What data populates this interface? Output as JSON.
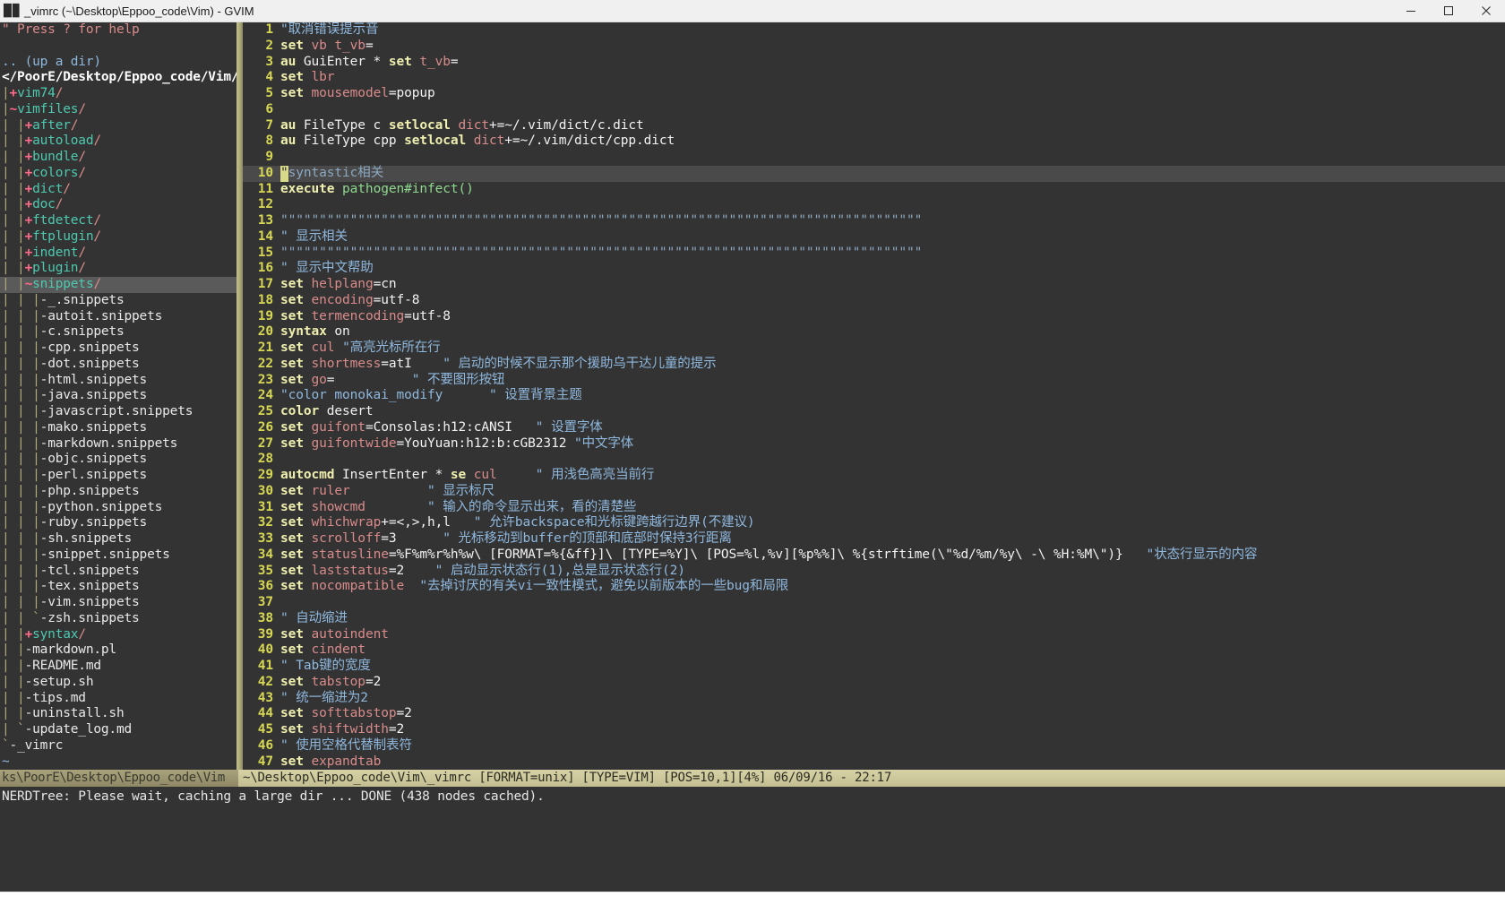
{
  "window": {
    "title": "_vimrc (~\\Desktop\\Eppoo_code\\Vim) - GVIM",
    "icon": "gvim-icon",
    "minimize_label": "─",
    "maximize_label": "❐",
    "close_label": "✕"
  },
  "nerdtree": {
    "help_line": "\" Press ? for help",
    "blank_line": "",
    "up_a_dir": ".. (up a dir)",
    "root_path": "</PoorE/Desktop/Eppoo_code/Vim/",
    "items": [
      {
        "indent": "|",
        "marker": "+",
        "label": "vim74/",
        "type": "dir"
      },
      {
        "indent": "|",
        "marker": "~",
        "label": "vimfiles/",
        "type": "dir"
      },
      {
        "indent": "| |",
        "marker": "+",
        "label": "after/",
        "type": "dir"
      },
      {
        "indent": "| |",
        "marker": "+",
        "label": "autoload/",
        "type": "dir"
      },
      {
        "indent": "| |",
        "marker": "+",
        "label": "bundle/",
        "type": "dir"
      },
      {
        "indent": "| |",
        "marker": "+",
        "label": "colors/",
        "type": "dir"
      },
      {
        "indent": "| |",
        "marker": "+",
        "label": "dict/",
        "type": "dir"
      },
      {
        "indent": "| |",
        "marker": "+",
        "label": "doc/",
        "type": "dir"
      },
      {
        "indent": "| |",
        "marker": "+",
        "label": "ftdetect/",
        "type": "dir"
      },
      {
        "indent": "| |",
        "marker": "+",
        "label": "ftplugin/",
        "type": "dir"
      },
      {
        "indent": "| |",
        "marker": "+",
        "label": "indent/",
        "type": "dir"
      },
      {
        "indent": "| |",
        "marker": "+",
        "label": "plugin/",
        "type": "dir"
      },
      {
        "indent": "| |",
        "marker": "~",
        "label": "snippets/",
        "type": "dir",
        "selected": true
      },
      {
        "indent": "| | |",
        "marker": "-",
        "label": "_.snippets",
        "type": "file"
      },
      {
        "indent": "| | |",
        "marker": "-",
        "label": "autoit.snippets",
        "type": "file"
      },
      {
        "indent": "| | |",
        "marker": "-",
        "label": "c.snippets",
        "type": "file"
      },
      {
        "indent": "| | |",
        "marker": "-",
        "label": "cpp.snippets",
        "type": "file"
      },
      {
        "indent": "| | |",
        "marker": "-",
        "label": "dot.snippets",
        "type": "file"
      },
      {
        "indent": "| | |",
        "marker": "-",
        "label": "html.snippets",
        "type": "file"
      },
      {
        "indent": "| | |",
        "marker": "-",
        "label": "java.snippets",
        "type": "file"
      },
      {
        "indent": "| | |",
        "marker": "-",
        "label": "javascript.snippets",
        "type": "file"
      },
      {
        "indent": "| | |",
        "marker": "-",
        "label": "mako.snippets",
        "type": "file"
      },
      {
        "indent": "| | |",
        "marker": "-",
        "label": "markdown.snippets",
        "type": "file"
      },
      {
        "indent": "| | |",
        "marker": "-",
        "label": "objc.snippets",
        "type": "file"
      },
      {
        "indent": "| | |",
        "marker": "-",
        "label": "perl.snippets",
        "type": "file"
      },
      {
        "indent": "| | |",
        "marker": "-",
        "label": "php.snippets",
        "type": "file"
      },
      {
        "indent": "| | |",
        "marker": "-",
        "label": "python.snippets",
        "type": "file"
      },
      {
        "indent": "| | |",
        "marker": "-",
        "label": "ruby.snippets",
        "type": "file"
      },
      {
        "indent": "| | |",
        "marker": "-",
        "label": "sh.snippets",
        "type": "file"
      },
      {
        "indent": "| | |",
        "marker": "-",
        "label": "snippet.snippets",
        "type": "file"
      },
      {
        "indent": "| | |",
        "marker": "-",
        "label": "tcl.snippets",
        "type": "file"
      },
      {
        "indent": "| | |",
        "marker": "-",
        "label": "tex.snippets",
        "type": "file"
      },
      {
        "indent": "| | |",
        "marker": "-",
        "label": "vim.snippets",
        "type": "file"
      },
      {
        "indent": "| | `",
        "marker": "-",
        "label": "zsh.snippets",
        "type": "file"
      },
      {
        "indent": "| |",
        "marker": "+",
        "label": "syntax/",
        "type": "dir"
      },
      {
        "indent": "| |",
        "marker": "-",
        "label": "markdown.pl",
        "type": "file"
      },
      {
        "indent": "| |",
        "marker": "-",
        "label": "README.md",
        "type": "file"
      },
      {
        "indent": "| |",
        "marker": "-",
        "label": "setup.sh",
        "type": "file"
      },
      {
        "indent": "| |",
        "marker": "-",
        "label": "tips.md",
        "type": "file"
      },
      {
        "indent": "| |",
        "marker": "-",
        "label": "uninstall.sh",
        "type": "file"
      },
      {
        "indent": "| `",
        "marker": "-",
        "label": "update_log.md",
        "type": "file"
      },
      {
        "indent": "`",
        "marker": "-",
        "label": "_vimrc",
        "type": "file"
      }
    ]
  },
  "editor": {
    "lines": [
      {
        "n": 1,
        "segs": [
          {
            "t": "\"取消错误提示音",
            "c": "c-cmt"
          }
        ]
      },
      {
        "n": 2,
        "segs": [
          {
            "t": "set ",
            "c": "c-kw"
          },
          {
            "t": "vb t_vb",
            "c": "c-opt"
          },
          {
            "t": "=",
            "c": "c-white"
          }
        ]
      },
      {
        "n": 3,
        "segs": [
          {
            "t": "au ",
            "c": "c-kw"
          },
          {
            "t": "GuiEnter * ",
            "c": "c-white"
          },
          {
            "t": "set ",
            "c": "c-kw"
          },
          {
            "t": "t_vb",
            "c": "c-opt"
          },
          {
            "t": "=",
            "c": "c-white"
          }
        ]
      },
      {
        "n": 4,
        "segs": [
          {
            "t": "set ",
            "c": "c-kw"
          },
          {
            "t": "lbr",
            "c": "c-opt"
          }
        ]
      },
      {
        "n": 5,
        "segs": [
          {
            "t": "set ",
            "c": "c-kw"
          },
          {
            "t": "mousemodel",
            "c": "c-opt"
          },
          {
            "t": "=popup",
            "c": "c-white"
          }
        ]
      },
      {
        "n": 6,
        "segs": []
      },
      {
        "n": 7,
        "segs": [
          {
            "t": "au ",
            "c": "c-kw"
          },
          {
            "t": "FileType c ",
            "c": "c-white"
          },
          {
            "t": "setlocal ",
            "c": "c-kw"
          },
          {
            "t": "dict",
            "c": "c-opt"
          },
          {
            "t": "+=~/.vim/dict/c.dict",
            "c": "c-white"
          }
        ]
      },
      {
        "n": 8,
        "segs": [
          {
            "t": "au ",
            "c": "c-kw"
          },
          {
            "t": "FileType cpp ",
            "c": "c-white"
          },
          {
            "t": "setlocal ",
            "c": "c-kw"
          },
          {
            "t": "dict",
            "c": "c-opt"
          },
          {
            "t": "+=~/.vim/dict/cpp.dict",
            "c": "c-white"
          }
        ]
      },
      {
        "n": 9,
        "segs": []
      },
      {
        "n": 10,
        "cursorline": true,
        "cursor": "\"",
        "segs": [
          {
            "t": "syntastic相关",
            "c": "c-cmt2"
          }
        ]
      },
      {
        "n": 11,
        "segs": [
          {
            "t": "execute ",
            "c": "c-kw"
          },
          {
            "t": "pathogen#infect()",
            "c": "c-fn"
          }
        ]
      },
      {
        "n": 12,
        "segs": []
      },
      {
        "n": 13,
        "segs": [
          {
            "t": "\"\"\"\"\"\"\"\"\"\"\"\"\"\"\"\"\"\"\"\"\"\"\"\"\"\"\"\"\"\"\"\"\"\"\"\"\"\"\"\"\"\"\"\"\"\"\"\"\"\"\"\"\"\"\"\"\"\"\"\"\"\"\"\"\"\"\"\"\"\"\"\"\"\"\"\"\"\"\"\"\"\"\"",
            "c": "c-cmt2"
          }
        ]
      },
      {
        "n": 14,
        "segs": [
          {
            "t": "\" 显示相关",
            "c": "c-cmt"
          }
        ]
      },
      {
        "n": 15,
        "segs": [
          {
            "t": "\"\"\"\"\"\"\"\"\"\"\"\"\"\"\"\"\"\"\"\"\"\"\"\"\"\"\"\"\"\"\"\"\"\"\"\"\"\"\"\"\"\"\"\"\"\"\"\"\"\"\"\"\"\"\"\"\"\"\"\"\"\"\"\"\"\"\"\"\"\"\"\"\"\"\"\"\"\"\"\"\"\"\"",
            "c": "c-cmt2"
          }
        ]
      },
      {
        "n": 16,
        "segs": [
          {
            "t": "\" 显示中文帮助",
            "c": "c-cmt"
          }
        ]
      },
      {
        "n": 17,
        "segs": [
          {
            "t": "set ",
            "c": "c-kw"
          },
          {
            "t": "helplang",
            "c": "c-opt"
          },
          {
            "t": "=cn",
            "c": "c-white"
          }
        ]
      },
      {
        "n": 18,
        "segs": [
          {
            "t": "set ",
            "c": "c-kw"
          },
          {
            "t": "encoding",
            "c": "c-opt"
          },
          {
            "t": "=utf-8",
            "c": "c-white"
          }
        ]
      },
      {
        "n": 19,
        "segs": [
          {
            "t": "set ",
            "c": "c-kw"
          },
          {
            "t": "termencoding",
            "c": "c-opt"
          },
          {
            "t": "=utf-8",
            "c": "c-white"
          }
        ]
      },
      {
        "n": 20,
        "segs": [
          {
            "t": "syntax ",
            "c": "c-kw"
          },
          {
            "t": "on",
            "c": "c-white"
          }
        ]
      },
      {
        "n": 21,
        "segs": [
          {
            "t": "set ",
            "c": "c-kw"
          },
          {
            "t": "cul ",
            "c": "c-opt"
          },
          {
            "t": "\"高亮光标所在行",
            "c": "c-cmt"
          }
        ]
      },
      {
        "n": 22,
        "segs": [
          {
            "t": "set ",
            "c": "c-kw"
          },
          {
            "t": "shortmess",
            "c": "c-opt"
          },
          {
            "t": "=atI",
            "c": "c-white"
          },
          {
            "t": "    \" 启动的时候不显示那个援助乌干达儿童的提示",
            "c": "c-cmt"
          }
        ]
      },
      {
        "n": 23,
        "segs": [
          {
            "t": "set ",
            "c": "c-kw"
          },
          {
            "t": "go",
            "c": "c-opt"
          },
          {
            "t": "=",
            "c": "c-white"
          },
          {
            "t": "          \" 不要图形按钮",
            "c": "c-cmt"
          }
        ]
      },
      {
        "n": 24,
        "segs": [
          {
            "t": "\"color monokai_modify      \" 设置背景主题",
            "c": "c-cmt"
          }
        ]
      },
      {
        "n": 25,
        "segs": [
          {
            "t": "color ",
            "c": "c-kw"
          },
          {
            "t": "desert",
            "c": "c-white"
          }
        ]
      },
      {
        "n": 26,
        "segs": [
          {
            "t": "set ",
            "c": "c-kw"
          },
          {
            "t": "guifont",
            "c": "c-opt"
          },
          {
            "t": "=Consolas:h12:cANSI",
            "c": "c-white"
          },
          {
            "t": "   \" 设置字体",
            "c": "c-cmt"
          }
        ]
      },
      {
        "n": 27,
        "segs": [
          {
            "t": "set ",
            "c": "c-kw"
          },
          {
            "t": "guifontwide",
            "c": "c-opt"
          },
          {
            "t": "=YouYuan:h12:b:cGB2312 ",
            "c": "c-white"
          },
          {
            "t": "\"中文字体",
            "c": "c-cmt"
          }
        ]
      },
      {
        "n": 28,
        "segs": []
      },
      {
        "n": 29,
        "segs": [
          {
            "t": "autocmd ",
            "c": "c-kw"
          },
          {
            "t": "InsertEnter * ",
            "c": "c-white"
          },
          {
            "t": "se ",
            "c": "c-kw"
          },
          {
            "t": "cul",
            "c": "c-opt"
          },
          {
            "t": "     \" 用浅色高亮当前行",
            "c": "c-cmt"
          }
        ]
      },
      {
        "n": 30,
        "segs": [
          {
            "t": "set ",
            "c": "c-kw"
          },
          {
            "t": "ruler",
            "c": "c-opt"
          },
          {
            "t": "          \" 显示标尺",
            "c": "c-cmt"
          }
        ]
      },
      {
        "n": 31,
        "segs": [
          {
            "t": "set ",
            "c": "c-kw"
          },
          {
            "t": "showcmd",
            "c": "c-opt"
          },
          {
            "t": "        \" 输入的命令显示出来，看的清楚些",
            "c": "c-cmt"
          }
        ]
      },
      {
        "n": 32,
        "segs": [
          {
            "t": "set ",
            "c": "c-kw"
          },
          {
            "t": "whichwrap",
            "c": "c-opt"
          },
          {
            "t": "+=<,>,h,l",
            "c": "c-white"
          },
          {
            "t": "   \" 允许backspace和光标键跨越行边界(不建议)",
            "c": "c-cmt"
          }
        ]
      },
      {
        "n": 33,
        "segs": [
          {
            "t": "set ",
            "c": "c-kw"
          },
          {
            "t": "scrolloff",
            "c": "c-opt"
          },
          {
            "t": "=3",
            "c": "c-white"
          },
          {
            "t": "      \" 光标移动到buffer的顶部和底部时保持3行距离",
            "c": "c-cmt"
          }
        ]
      },
      {
        "n": 34,
        "segs": [
          {
            "t": "set ",
            "c": "c-kw"
          },
          {
            "t": "statusline",
            "c": "c-opt"
          },
          {
            "t": "=%F%m%r%h%w\\ [FORMAT=%{&ff}]\\ [TYPE=%Y]\\ [POS=%l,%v][%p%%]\\ %{strftime(\\\"%d/%m/%y\\ -\\ %H:%M\\\")}",
            "c": "c-white"
          },
          {
            "t": "   \"状态行显示的内容",
            "c": "c-cmt"
          }
        ]
      },
      {
        "n": 35,
        "segs": [
          {
            "t": "set ",
            "c": "c-kw"
          },
          {
            "t": "laststatus",
            "c": "c-opt"
          },
          {
            "t": "=2",
            "c": "c-white"
          },
          {
            "t": "    \" 启动显示状态行(1),总是显示状态行(2)",
            "c": "c-cmt"
          }
        ]
      },
      {
        "n": 36,
        "segs": [
          {
            "t": "set ",
            "c": "c-kw"
          },
          {
            "t": "nocompatible",
            "c": "c-opt"
          },
          {
            "t": "  \"去掉讨厌的有关vi一致性模式，避免以前版本的一些bug和局限",
            "c": "c-cmt"
          }
        ]
      },
      {
        "n": 37,
        "segs": []
      },
      {
        "n": 38,
        "segs": [
          {
            "t": "\" 自动缩进",
            "c": "c-cmt"
          }
        ]
      },
      {
        "n": 39,
        "segs": [
          {
            "t": "set ",
            "c": "c-kw"
          },
          {
            "t": "autoindent",
            "c": "c-opt"
          }
        ]
      },
      {
        "n": 40,
        "segs": [
          {
            "t": "set ",
            "c": "c-kw"
          },
          {
            "t": "cindent",
            "c": "c-opt"
          }
        ]
      },
      {
        "n": 41,
        "segs": [
          {
            "t": "\" Tab键的宽度",
            "c": "c-cmt"
          }
        ]
      },
      {
        "n": 42,
        "segs": [
          {
            "t": "set ",
            "c": "c-kw"
          },
          {
            "t": "tabstop",
            "c": "c-opt"
          },
          {
            "t": "=2",
            "c": "c-white"
          }
        ]
      },
      {
        "n": 43,
        "segs": [
          {
            "t": "\" 统一缩进为2",
            "c": "c-cmt"
          }
        ]
      },
      {
        "n": 44,
        "segs": [
          {
            "t": "set ",
            "c": "c-kw"
          },
          {
            "t": "softtabstop",
            "c": "c-opt"
          },
          {
            "t": "=2",
            "c": "c-white"
          }
        ]
      },
      {
        "n": 45,
        "segs": [
          {
            "t": "set ",
            "c": "c-kw"
          },
          {
            "t": "shiftwidth",
            "c": "c-opt"
          },
          {
            "t": "=2",
            "c": "c-white"
          }
        ]
      },
      {
        "n": 46,
        "segs": [
          {
            "t": "\" 使用空格代替制表符",
            "c": "c-cmt"
          }
        ]
      },
      {
        "n": 47,
        "segs": [
          {
            "t": "set ",
            "c": "c-kw"
          },
          {
            "t": "expandtab",
            "c": "c-opt"
          }
        ]
      }
    ]
  },
  "status": {
    "left": "ks\\PoorE\\Desktop\\Eppoo_code\\Vim",
    "right": "~\\Desktop\\Eppoo_code\\Vim\\_vimrc [FORMAT=unix] [TYPE=VIM] [POS=10,1][4%] 06/09/16 - 22:17",
    "command_line": "NERDTree: Please wait, caching a large dir ... DONE (438 nodes cached)."
  },
  "colors": {
    "background": "#333333",
    "statusline_active": "#cbc79a",
    "statusline_inactive": "#9a9470",
    "linenumber": "#d7d754",
    "cursor": "#d9d98a",
    "directory": "#4ec9b0",
    "comment": "#8fb8de"
  }
}
